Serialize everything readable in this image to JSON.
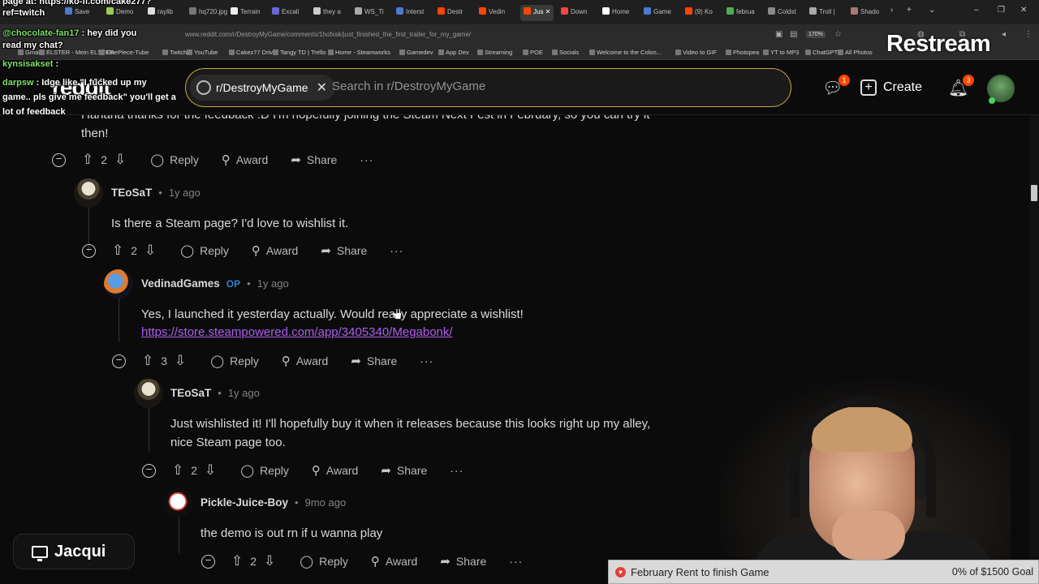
{
  "browser": {
    "tabs": [
      {
        "label": "Save",
        "color": "#4a7bd0"
      },
      {
        "label": "Demo",
        "color": "#9c5"
      },
      {
        "label": "raylib",
        "color": "#ddd"
      },
      {
        "label": "hq720.jpg",
        "color": "#777"
      },
      {
        "label": "Terrain",
        "color": "#eee"
      },
      {
        "label": "Excali",
        "color": "#6965db"
      },
      {
        "label": "they a",
        "color": "#ccc"
      },
      {
        "label": "WS_Ti",
        "color": "#aaa"
      },
      {
        "label": "Interst",
        "color": "#4a7bd0"
      },
      {
        "label": "Destr",
        "color": "#ff4500"
      },
      {
        "label": "Vedin",
        "color": "#ff4500"
      },
      {
        "label": "Jus",
        "color": "#ff4500"
      },
      {
        "label": "Down",
        "color": "#e44"
      },
      {
        "label": "Home",
        "color": "#fff"
      },
      {
        "label": "Game",
        "color": "#4a7bd0"
      },
      {
        "label": "(9) Ko",
        "color": "#ff4500"
      },
      {
        "label": "februa",
        "color": "#4caf50"
      },
      {
        "label": "Coldst",
        "color": "#888"
      },
      {
        "label": "Troll |",
        "color": "#aaa"
      },
      {
        "label": "Shado",
        "color": "#a77"
      }
    ],
    "url": "www.reddit.com/r/DestroyMyGame/comments/1hofxsk/just_finished_the_first_trailer_for_my_game/",
    "zoom": "170%",
    "bookmarks": [
      "Gmail",
      "ELSTER - Mein ELSTER",
      "OnePiece-Tube",
      "Twitch",
      "YouTube",
      "Cakez77 Drive",
      "Tangy TD | Trello",
      "Home - Steamworks",
      "Gamedev",
      "App Dev",
      "Streaming",
      "POE",
      "Socials",
      "Welcome to the Colon...",
      "Video to GIF",
      "Photopea",
      "YT to MP3",
      "ChatGPT",
      "All Photos"
    ]
  },
  "reddit": {
    "logo": "reddit",
    "subreddit_chip": "r/DestroyMyGame",
    "search_placeholder": "Search in r/DestroyMyGame",
    "chat_badge": "1",
    "create_label": "Create",
    "notif_badge": "3"
  },
  "overlay": {
    "restream": "Restream",
    "chat": [
      {
        "user": "",
        "text": "page at: https://ko-fi.com/cake277?"
      },
      {
        "user": "",
        "text": "ref=twitch"
      },
      {
        "user": "@chocolate-fan17",
        "text": " : hey did you"
      },
      {
        "user": "",
        "text": "read my chat?"
      },
      {
        "user": "kynsisakset",
        "text": " :"
      },
      {
        "user": "darpsw",
        "text": " : Idge like \"I fucked up my"
      },
      {
        "user": "",
        "text": "game.. pls give me feedback\" you'll get a"
      },
      {
        "user": "",
        "text": "lot of feedback"
      }
    ],
    "streamer_name": "Jacqui",
    "goal_label": "February Rent to finish Game",
    "goal_status": "0% of $1500 Goal",
    "goal_fraction": 0
  },
  "comments": [
    {
      "id": "c0",
      "text_lines": [
        "Hahaha thanks for the feedback :D I'm hopefully joining the Steam Next Fest in February, so you can try it",
        "then!"
      ],
      "votes": "2"
    },
    {
      "id": "c1",
      "user": "TEoSaT",
      "op": "",
      "time": "1y ago",
      "text_lines": [
        "Is there a Steam page? I'd love to wishlist it."
      ],
      "votes": "2"
    },
    {
      "id": "c2",
      "user": "VedinadGames",
      "op": "OP",
      "time": "1y ago",
      "text_lines": [
        "Yes, I launched it yesterday actually. Would really appreciate a wishlist!"
      ],
      "link": "https://store.steampowered.com/app/3405340/Megabonk/",
      "votes": "3"
    },
    {
      "id": "c3",
      "user": "TEoSaT",
      "op": "",
      "time": "1y ago",
      "text_lines": [
        "Just wishlisted it! I'll hopefully buy it when it releases because this looks right up my alley,",
        "nice Steam page too."
      ],
      "votes": "2"
    },
    {
      "id": "c4",
      "user": "Pickle-Juice-Boy",
      "op": "",
      "time": "9mo ago",
      "text_lines": [
        "the demo is out rn if u wanna play"
      ],
      "votes": "2"
    }
  ],
  "actions": {
    "reply": "Reply",
    "award": "Award",
    "share": "Share",
    "more": "···"
  },
  "icons": {
    "upvote": "upvote-icon",
    "downvote": "downvote-icon",
    "reply": "reply-icon",
    "award": "award-icon",
    "share": "share-icon",
    "collapse": "collapse-icon"
  }
}
